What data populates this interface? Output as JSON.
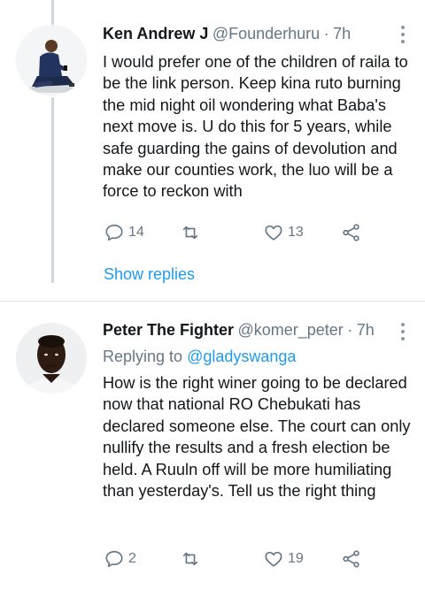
{
  "tweets": [
    {
      "name": "Ken Andrew J",
      "handle": "@Founderhuru",
      "separator": "·",
      "time": "7h",
      "text": "I would prefer one of the children of raila to be the link person. Keep kina ruto burning the mid night oil wondering what Baba's next move is. U do this for 5 years, while safe guarding the gains of devolution and make our counties work, the luo will be a force to reckon with",
      "reply_count": "14",
      "retweet_count": "",
      "like_count": "13",
      "show_replies": "Show replies"
    },
    {
      "name": "Peter The Fighter",
      "handle": "@komer_peter",
      "separator": "·",
      "time": "7h",
      "replying_prefix": "Replying to",
      "replying_to": "@gladyswanga",
      "text": "How is the right winer going to be declared now that national RO Chebukati has declared someone else. The court can only nullify the results and a fresh election be held.  A Ruuln off will be more humiliating than yesterday's. Tell us the right thing",
      "reply_count": "2",
      "retweet_count": "",
      "like_count": "19"
    }
  ],
  "icons": {
    "reply": "reply-icon",
    "retweet": "retweet-icon",
    "like": "heart-icon",
    "share": "share-icon",
    "more": "more-vertical-icon"
  },
  "colors": {
    "link": "#1d9bf0",
    "secondary_text": "#657786",
    "icon": "#657786",
    "thread_line": "#cfd9de"
  }
}
